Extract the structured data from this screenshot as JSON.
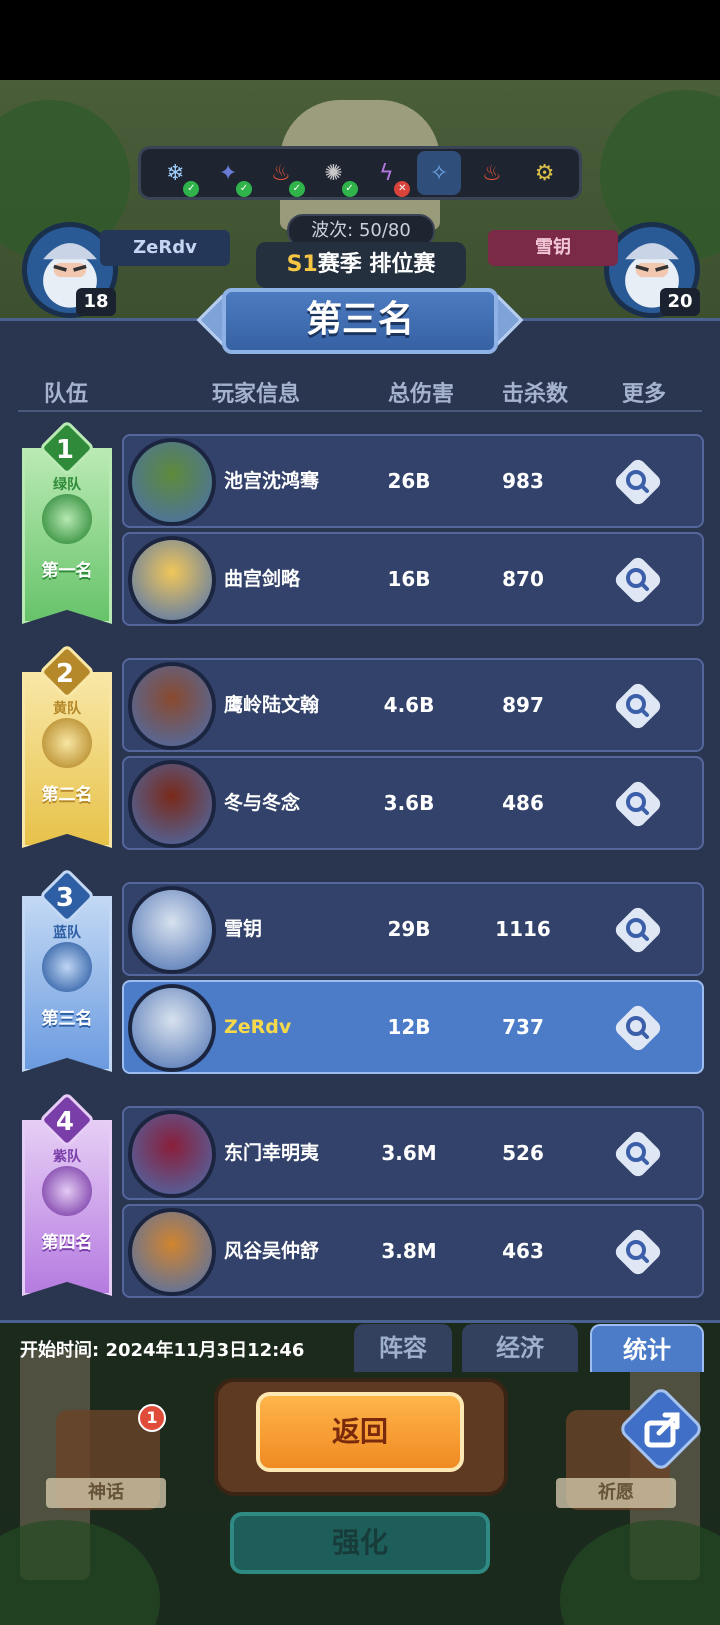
{
  "hud": {
    "left_player": {
      "name": "ZeRdv",
      "level": "18"
    },
    "right_player": {
      "name": "雪钥",
      "level": "20"
    },
    "wave": "波次: 50/80",
    "season_prefix": "S1",
    "season_text": "赛季 排位赛",
    "towers": [
      {
        "icon": "snowflake-icon",
        "status": "ok"
      },
      {
        "icon": "wizard-icon",
        "status": "ok"
      },
      {
        "icon": "fire-icon",
        "status": "ok"
      },
      {
        "icon": "wind-icon",
        "status": "ok"
      },
      {
        "icon": "lightning-icon",
        "status": "no"
      },
      {
        "icon": "ice-hero-icon",
        "status": "none"
      },
      {
        "icon": "fire-icon",
        "status": "none"
      },
      {
        "icon": "robot-icon",
        "status": "none"
      }
    ]
  },
  "panel": {
    "rank_title": "第三名",
    "headers": {
      "team": "队伍",
      "player": "玩家信息",
      "damage": "总伤害",
      "kills": "击杀数",
      "more": "更多"
    },
    "teams": [
      {
        "num": "1",
        "team": "绿队",
        "place": "第一名",
        "color": "#67c36a",
        "light": "#b9eab3",
        "dark": "#2f8a3a",
        "players": [
          {
            "name": "池宫沈鸿骞",
            "damage": "26B",
            "kills": "983",
            "avatar": "#5e8a3a"
          },
          {
            "name": "曲宫剑略",
            "damage": "16B",
            "kills": "870",
            "avatar": "#f1c75a"
          }
        ]
      },
      {
        "num": "2",
        "team": "黄队",
        "place": "第二名",
        "color": "#e7c24a",
        "light": "#f8e7a6",
        "dark": "#b5892a",
        "players": [
          {
            "name": "鹰岭陆文翰",
            "damage": "4.6B",
            "kills": "897",
            "avatar": "#8a4a2e"
          },
          {
            "name": "冬与冬念",
            "damage": "3.6B",
            "kills": "486",
            "avatar": "#7a2a1a"
          }
        ]
      },
      {
        "num": "3",
        "team": "蓝队",
        "place": "第三名",
        "color": "#6b9be0",
        "light": "#c2d8f4",
        "dark": "#2e5ea4",
        "players": [
          {
            "name": "雪钥",
            "damage": "29B",
            "kills": "1116",
            "avatar": "#d8e2ef"
          },
          {
            "name": "ZeRdv",
            "damage": "12B",
            "kills": "737",
            "avatar": "#d8e2ef",
            "me": true
          }
        ]
      },
      {
        "num": "4",
        "team": "紫队",
        "place": "第四名",
        "color": "#b57be0",
        "light": "#e6cdf5",
        "dark": "#7a3ea8",
        "players": [
          {
            "name": "东门幸明夷",
            "damage": "3.6M",
            "kills": "526",
            "avatar": "#8a1e3a"
          },
          {
            "name": "风谷吴仲舒",
            "damage": "3.8M",
            "kills": "463",
            "avatar": "#d1842e"
          }
        ]
      }
    ]
  },
  "footer": {
    "start_time": "开始时间: 2024年11月3日12:46",
    "tabs": [
      {
        "label": "阵容"
      },
      {
        "label": "经济"
      },
      {
        "label": "统计"
      }
    ],
    "active_tab": "统计",
    "return_label": "返回",
    "upgrade_label": "强化",
    "left_side_label": "神话",
    "right_side_label": "祈愿",
    "badge_count": "1"
  }
}
